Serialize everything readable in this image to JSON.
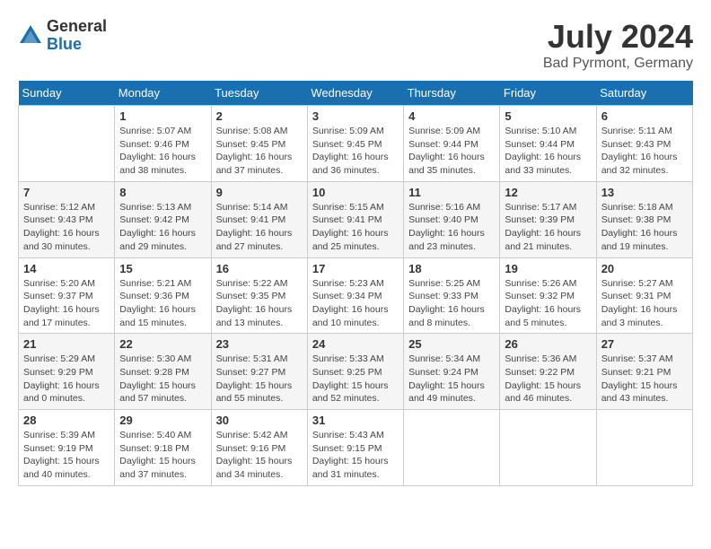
{
  "logo": {
    "general": "General",
    "blue": "Blue"
  },
  "title": {
    "month": "July 2024",
    "location": "Bad Pyrmont, Germany"
  },
  "calendar": {
    "headers": [
      "Sunday",
      "Monday",
      "Tuesday",
      "Wednesday",
      "Thursday",
      "Friday",
      "Saturday"
    ],
    "weeks": [
      [
        {
          "day": "",
          "info": ""
        },
        {
          "day": "1",
          "info": "Sunrise: 5:07 AM\nSunset: 9:46 PM\nDaylight: 16 hours\nand 38 minutes."
        },
        {
          "day": "2",
          "info": "Sunrise: 5:08 AM\nSunset: 9:45 PM\nDaylight: 16 hours\nand 37 minutes."
        },
        {
          "day": "3",
          "info": "Sunrise: 5:09 AM\nSunset: 9:45 PM\nDaylight: 16 hours\nand 36 minutes."
        },
        {
          "day": "4",
          "info": "Sunrise: 5:09 AM\nSunset: 9:44 PM\nDaylight: 16 hours\nand 35 minutes."
        },
        {
          "day": "5",
          "info": "Sunrise: 5:10 AM\nSunset: 9:44 PM\nDaylight: 16 hours\nand 33 minutes."
        },
        {
          "day": "6",
          "info": "Sunrise: 5:11 AM\nSunset: 9:43 PM\nDaylight: 16 hours\nand 32 minutes."
        }
      ],
      [
        {
          "day": "7",
          "info": "Sunrise: 5:12 AM\nSunset: 9:43 PM\nDaylight: 16 hours\nand 30 minutes."
        },
        {
          "day": "8",
          "info": "Sunrise: 5:13 AM\nSunset: 9:42 PM\nDaylight: 16 hours\nand 29 minutes."
        },
        {
          "day": "9",
          "info": "Sunrise: 5:14 AM\nSunset: 9:41 PM\nDaylight: 16 hours\nand 27 minutes."
        },
        {
          "day": "10",
          "info": "Sunrise: 5:15 AM\nSunset: 9:41 PM\nDaylight: 16 hours\nand 25 minutes."
        },
        {
          "day": "11",
          "info": "Sunrise: 5:16 AM\nSunset: 9:40 PM\nDaylight: 16 hours\nand 23 minutes."
        },
        {
          "day": "12",
          "info": "Sunrise: 5:17 AM\nSunset: 9:39 PM\nDaylight: 16 hours\nand 21 minutes."
        },
        {
          "day": "13",
          "info": "Sunrise: 5:18 AM\nSunset: 9:38 PM\nDaylight: 16 hours\nand 19 minutes."
        }
      ],
      [
        {
          "day": "14",
          "info": "Sunrise: 5:20 AM\nSunset: 9:37 PM\nDaylight: 16 hours\nand 17 minutes."
        },
        {
          "day": "15",
          "info": "Sunrise: 5:21 AM\nSunset: 9:36 PM\nDaylight: 16 hours\nand 15 minutes."
        },
        {
          "day": "16",
          "info": "Sunrise: 5:22 AM\nSunset: 9:35 PM\nDaylight: 16 hours\nand 13 minutes."
        },
        {
          "day": "17",
          "info": "Sunrise: 5:23 AM\nSunset: 9:34 PM\nDaylight: 16 hours\nand 10 minutes."
        },
        {
          "day": "18",
          "info": "Sunrise: 5:25 AM\nSunset: 9:33 PM\nDaylight: 16 hours\nand 8 minutes."
        },
        {
          "day": "19",
          "info": "Sunrise: 5:26 AM\nSunset: 9:32 PM\nDaylight: 16 hours\nand 5 minutes."
        },
        {
          "day": "20",
          "info": "Sunrise: 5:27 AM\nSunset: 9:31 PM\nDaylight: 16 hours\nand 3 minutes."
        }
      ],
      [
        {
          "day": "21",
          "info": "Sunrise: 5:29 AM\nSunset: 9:29 PM\nDaylight: 16 hours\nand 0 minutes."
        },
        {
          "day": "22",
          "info": "Sunrise: 5:30 AM\nSunset: 9:28 PM\nDaylight: 15 hours\nand 57 minutes."
        },
        {
          "day": "23",
          "info": "Sunrise: 5:31 AM\nSunset: 9:27 PM\nDaylight: 15 hours\nand 55 minutes."
        },
        {
          "day": "24",
          "info": "Sunrise: 5:33 AM\nSunset: 9:25 PM\nDaylight: 15 hours\nand 52 minutes."
        },
        {
          "day": "25",
          "info": "Sunrise: 5:34 AM\nSunset: 9:24 PM\nDaylight: 15 hours\nand 49 minutes."
        },
        {
          "day": "26",
          "info": "Sunrise: 5:36 AM\nSunset: 9:22 PM\nDaylight: 15 hours\nand 46 minutes."
        },
        {
          "day": "27",
          "info": "Sunrise: 5:37 AM\nSunset: 9:21 PM\nDaylight: 15 hours\nand 43 minutes."
        }
      ],
      [
        {
          "day": "28",
          "info": "Sunrise: 5:39 AM\nSunset: 9:19 PM\nDaylight: 15 hours\nand 40 minutes."
        },
        {
          "day": "29",
          "info": "Sunrise: 5:40 AM\nSunset: 9:18 PM\nDaylight: 15 hours\nand 37 minutes."
        },
        {
          "day": "30",
          "info": "Sunrise: 5:42 AM\nSunset: 9:16 PM\nDaylight: 15 hours\nand 34 minutes."
        },
        {
          "day": "31",
          "info": "Sunrise: 5:43 AM\nSunset: 9:15 PM\nDaylight: 15 hours\nand 31 minutes."
        },
        {
          "day": "",
          "info": ""
        },
        {
          "day": "",
          "info": ""
        },
        {
          "day": "",
          "info": ""
        }
      ]
    ]
  }
}
